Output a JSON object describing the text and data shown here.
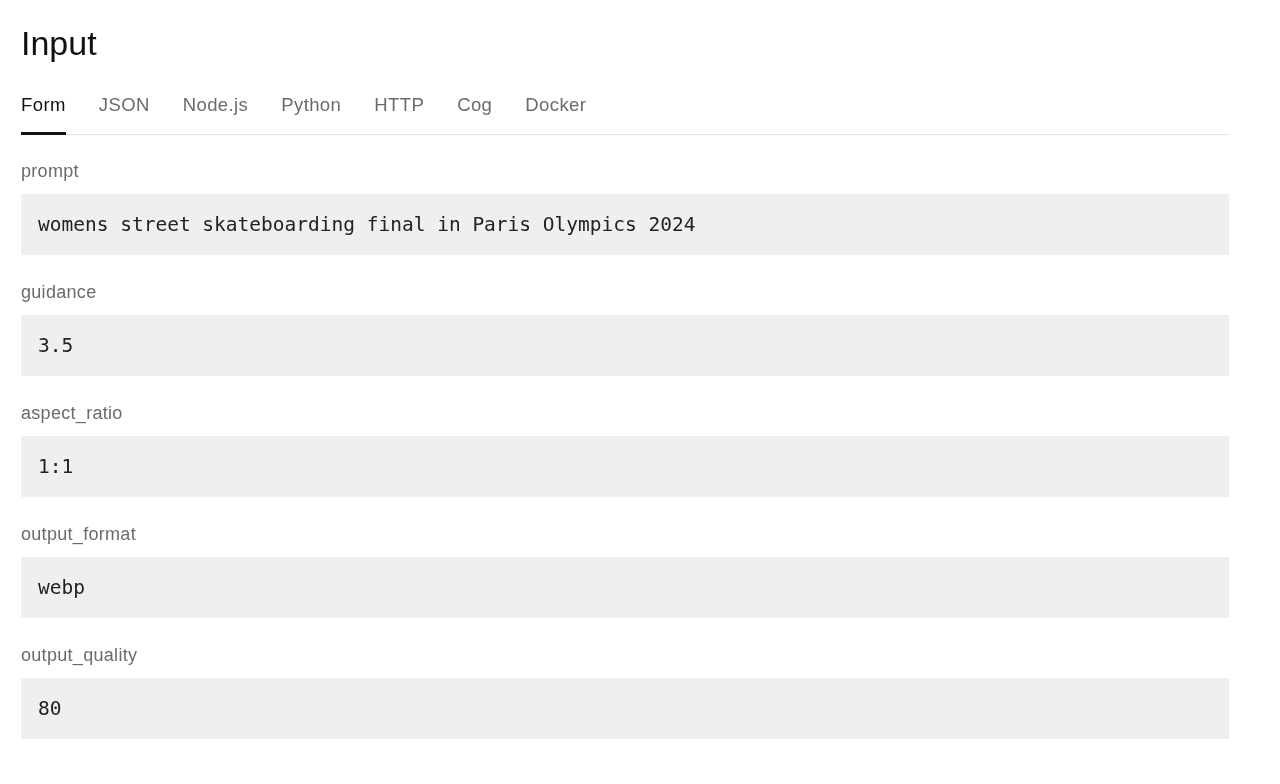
{
  "title": "Input",
  "tabs": [
    {
      "label": "Form",
      "selected": true
    },
    {
      "label": "JSON",
      "selected": false
    },
    {
      "label": "Node.js",
      "selected": false
    },
    {
      "label": "Python",
      "selected": false
    },
    {
      "label": "HTTP",
      "selected": false
    },
    {
      "label": "Cog",
      "selected": false
    },
    {
      "label": "Docker",
      "selected": false
    }
  ],
  "fields": [
    {
      "label": "prompt",
      "value": "womens street skateboarding final in Paris Olympics 2024"
    },
    {
      "label": "guidance",
      "value": "3.5"
    },
    {
      "label": "aspect_ratio",
      "value": "1:1"
    },
    {
      "label": "output_format",
      "value": "webp"
    },
    {
      "label": "output_quality",
      "value": "80"
    }
  ]
}
